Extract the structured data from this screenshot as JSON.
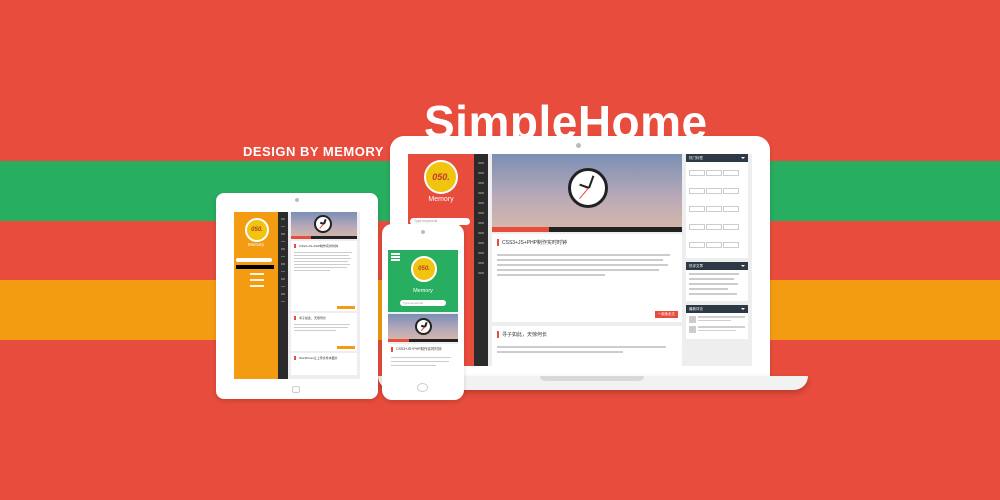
{
  "hero": {
    "title": "SimpleHome",
    "byline": "DESIGN BY MEMORY"
  },
  "site": {
    "name": "Memory",
    "logo_text": "050.",
    "search_placeholder": "Type keywords"
  },
  "laptop": {
    "post1_title": "CSS3+JS+PHP制作实时时钟",
    "post2_title": "寻子如此，天惊何长",
    "read_more": "+ 阅读全文",
    "widgets": [
      "热门标签",
      "热评文章",
      "最新评论"
    ]
  },
  "tablet": {
    "post_titles": [
      "CSS3+JS+PHP制作实时时钟",
      "寻子如此，天惊何长",
      "WordPress让上传文件夹图片"
    ]
  },
  "phone": {
    "post_title": "CSS3+JS+PHP制作实时时钟"
  },
  "colors": {
    "red": "#e74c3c",
    "green": "#27ae60",
    "orange": "#f39c12"
  },
  "icons": [
    "clock-icon",
    "search-icon",
    "menu-icon",
    "camera-icon"
  ]
}
